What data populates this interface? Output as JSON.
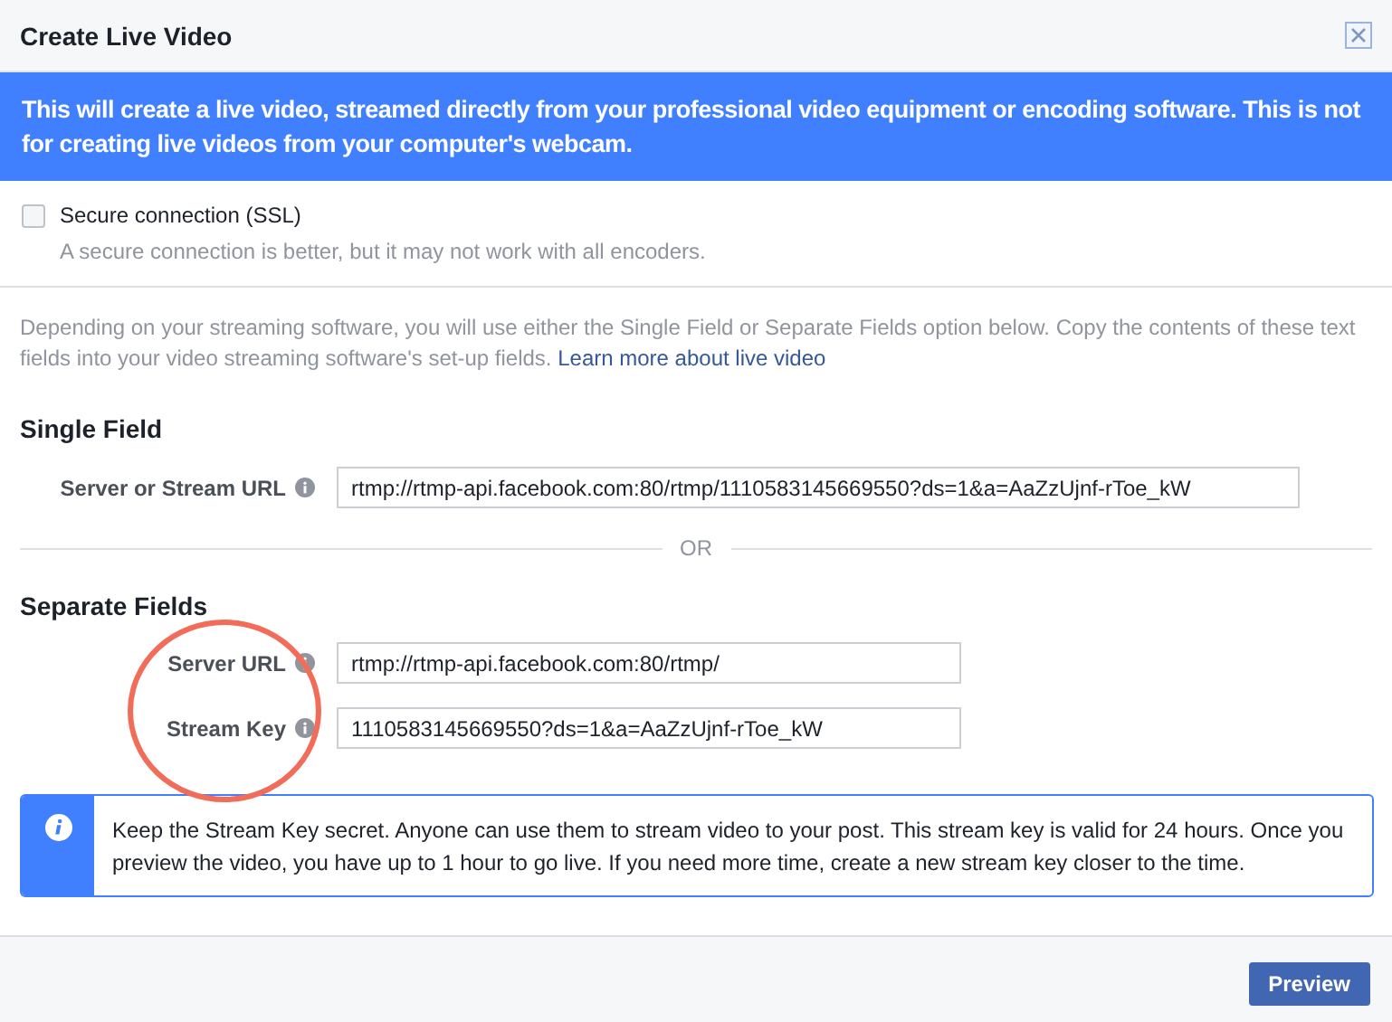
{
  "window": {
    "title": "Create Live Video"
  },
  "banner": "This will create a live video, streamed directly from your professional video equipment or encoding software. This is not for creating live videos from your computer's webcam.",
  "ssl": {
    "label": "Secure connection (SSL)",
    "checked": false,
    "hint": "A secure connection is better, but it may not work with all encoders."
  },
  "intro": {
    "text": "Depending on your streaming software, you will use either the Single Field or Separate Fields option below. Copy the contents of these text fields into your video streaming software's set-up fields.",
    "link": "Learn more about live video"
  },
  "single_field": {
    "heading": "Single Field",
    "fields": [
      {
        "label": "Server or Stream URL",
        "value": "rtmp://rtmp-api.facebook.com:80/rtmp/1110583145669550?ds=1&a=AaZzUjnf-rToe_kW"
      }
    ]
  },
  "separator": "OR",
  "separate_fields": {
    "heading": "Separate Fields",
    "fields": [
      {
        "label": "Server URL",
        "value": "rtmp://rtmp-api.facebook.com:80/rtmp/"
      },
      {
        "label": "Stream Key",
        "value": "1110583145669550?ds=1&a=AaZzUjnf-rToe_kW"
      }
    ]
  },
  "notice": "Keep the Stream Key secret. Anyone can use them to stream video to your post. This stream key is valid for 24 hours. Once you preview the video, you have up to 1 hour to go live. If you need more time, create a new stream key closer to the time.",
  "buttons": [
    "Preview"
  ]
}
